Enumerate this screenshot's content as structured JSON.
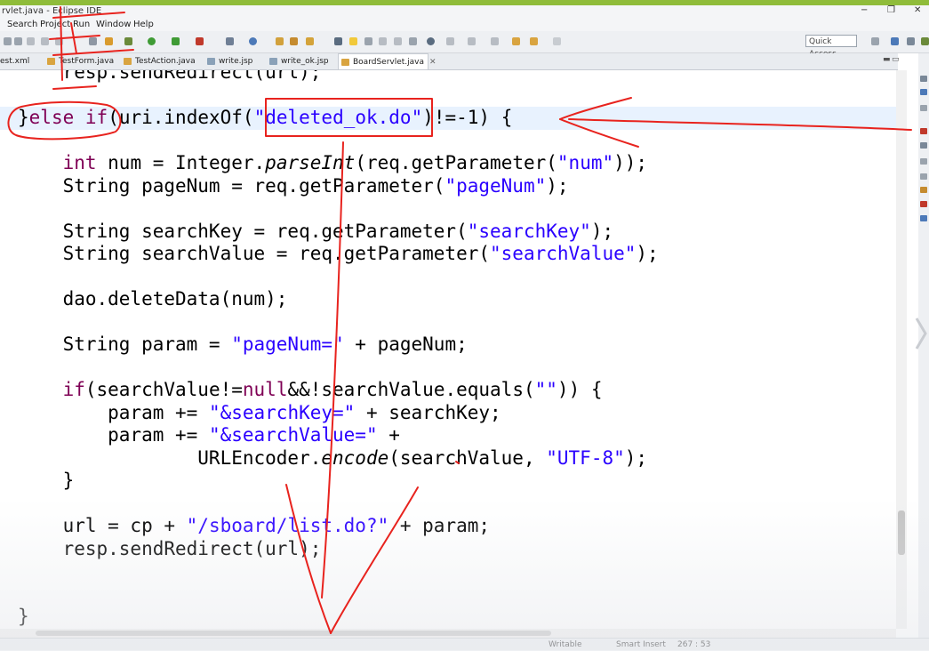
{
  "window": {
    "title": "rvlet.java - Eclipse IDE",
    "controls": [
      "−",
      "❐",
      "✕"
    ]
  },
  "menu": [
    "Search",
    "Project",
    "Run",
    "Window",
    "Help"
  ],
  "toolbar": {
    "quick_access": "Quick Access"
  },
  "tabs": [
    {
      "label": "est.xml",
      "active": false
    },
    {
      "label": "TestForm.java",
      "active": false
    },
    {
      "label": "TestAction.java",
      "active": false
    },
    {
      "label": "write.jsp",
      "active": false
    },
    {
      "label": "write_ok.jsp",
      "active": false
    },
    {
      "label": "BoardServlet.java",
      "active": true,
      "close": "✕"
    }
  ],
  "editor": {
    "lines": [
      {
        "parts": [
          {
            "t": "    resp.sendRedirect(url);"
          }
        ]
      },
      {
        "parts": [
          {
            "t": ""
          }
        ]
      },
      {
        "parts": [
          {
            "t": "}"
          },
          {
            "t": "else",
            "c": "kw"
          },
          {
            "t": " "
          },
          {
            "t": "if",
            "c": "kw"
          },
          {
            "t": "(uri.indexOf("
          },
          {
            "t": "\"deleted_ok.do\"",
            "c": "str"
          },
          {
            "t": ")!=-1) {"
          }
        ]
      },
      {
        "parts": [
          {
            "t": ""
          }
        ]
      },
      {
        "parts": [
          {
            "t": "    "
          },
          {
            "t": "int",
            "c": "kw"
          },
          {
            "t": " num = Integer."
          },
          {
            "t": "parseInt",
            "c": "it"
          },
          {
            "t": "(req.getParameter("
          },
          {
            "t": "\"num\"",
            "c": "str"
          },
          {
            "t": "));"
          }
        ]
      },
      {
        "parts": [
          {
            "t": "    String pageNum = req.getParameter("
          },
          {
            "t": "\"pageNum\"",
            "c": "str"
          },
          {
            "t": ");"
          }
        ]
      },
      {
        "parts": [
          {
            "t": ""
          }
        ]
      },
      {
        "parts": [
          {
            "t": "    String searchKey = req.getParameter("
          },
          {
            "t": "\"searchKey\"",
            "c": "str"
          },
          {
            "t": ");"
          }
        ]
      },
      {
        "parts": [
          {
            "t": "    String searchValue = req.getParameter("
          },
          {
            "t": "\"searchValue\"",
            "c": "str"
          },
          {
            "t": ");"
          }
        ]
      },
      {
        "parts": [
          {
            "t": ""
          }
        ]
      },
      {
        "parts": [
          {
            "t": "    dao.deleteData(num);"
          }
        ]
      },
      {
        "parts": [
          {
            "t": ""
          }
        ]
      },
      {
        "parts": [
          {
            "t": "    String param = "
          },
          {
            "t": "\"pageNum=\"",
            "c": "str"
          },
          {
            "t": " + pageNum;"
          }
        ]
      },
      {
        "parts": [
          {
            "t": ""
          }
        ]
      },
      {
        "parts": [
          {
            "t": "    "
          },
          {
            "t": "if",
            "c": "kw"
          },
          {
            "t": "(searchValue!="
          },
          {
            "t": "null",
            "c": "kw"
          },
          {
            "t": "&&!searchValue.equals("
          },
          {
            "t": "\"\"",
            "c": "str"
          },
          {
            "t": ")) {"
          }
        ]
      },
      {
        "parts": [
          {
            "t": "        param += "
          },
          {
            "t": "\"&searchKey=\"",
            "c": "str"
          },
          {
            "t": " + searchKey;"
          }
        ]
      },
      {
        "parts": [
          {
            "t": "        param += "
          },
          {
            "t": "\"&searchValue=\"",
            "c": "str"
          },
          {
            "t": " +"
          }
        ]
      },
      {
        "parts": [
          {
            "t": "                URLEncoder."
          },
          {
            "t": "encode",
            "c": "it"
          },
          {
            "t": "(searchValue, "
          },
          {
            "t": "\"UTF-8\"",
            "c": "str"
          },
          {
            "t": ");"
          }
        ]
      },
      {
        "parts": [
          {
            "t": "    }"
          }
        ]
      },
      {
        "parts": [
          {
            "t": ""
          }
        ]
      },
      {
        "parts": [
          {
            "t": "    url = cp + "
          },
          {
            "t": "\"/sboard/list.do?\"",
            "c": "str"
          },
          {
            "t": " + param;"
          }
        ]
      },
      {
        "parts": [
          {
            "t": "    resp.sendRedirect(url);"
          }
        ]
      },
      {
        "parts": [
          {
            "t": ""
          }
        ]
      },
      {
        "parts": [
          {
            "t": ""
          }
        ]
      },
      {
        "parts": [
          {
            "t": "}"
          }
        ]
      }
    ]
  },
  "status": {
    "mode": "Writable",
    "insert": "Smart Insert",
    "position": "267 : 53"
  },
  "colors": {
    "keyword": "#7f0055",
    "string": "#2a00ff",
    "annotation": "#e8231e",
    "accent": "#8fbc3a"
  }
}
